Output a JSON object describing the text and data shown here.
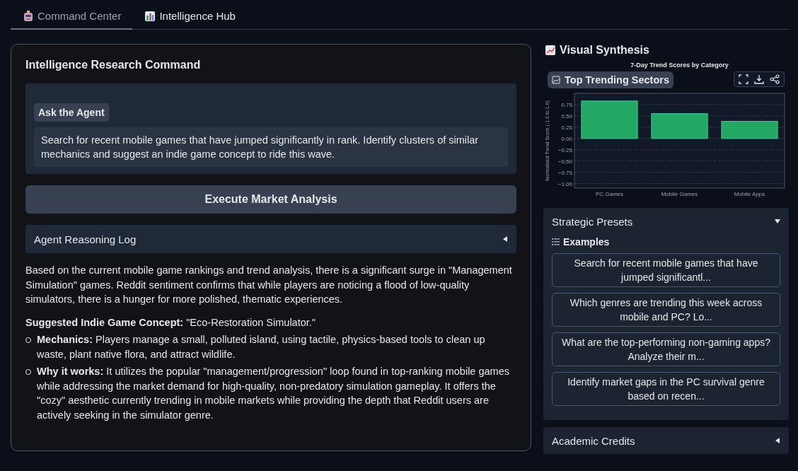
{
  "tabs": [
    {
      "label": "Command Center",
      "selected": true
    },
    {
      "label": "Intelligence Hub",
      "selected": false
    }
  ],
  "command": {
    "title": "Intelligence Research Command",
    "agent_label": "Ask the Agent",
    "query": "Search for recent mobile games that have jumped significantly in rank. Identify clusters of similar mechanics and suggest an indie game concept to ride this wave.",
    "execute_button": "Execute Market Analysis",
    "log": {
      "title": "Agent Reasoning Log",
      "expanded": false
    },
    "response": {
      "intro": "Based on the current mobile game rankings and trend analysis, there is a significant surge in \"Management Simulation\" games. Reddit sentiment confirms that while players are noticing a flood of low-quality simulators, there is a hunger for more polished, thematic experiences.",
      "concept": "**Suggested Indie Game Concept:** \"Eco-Restoration Simulator.\"",
      "bullets": [
        "**Mechanics:** Players manage a small, polluted island, using tactile, physics-based tools to clean up waste, plant native flora, and attract wildlife.",
        "**Why it works:** It utilizes the popular \"management/progression\" loop found in top-ranking mobile games while addressing the market demand for high-quality, non-predatory simulation gameplay. It offers the \"cozy\" aesthetic currently trending in mobile markets while providing the depth that Reddit users are actively seeking in the simulator genre."
      ]
    }
  },
  "visual": {
    "title": "Visual Synthesis",
    "plot_label": "Top Trending Sectors",
    "chart_data": {
      "type": "bar",
      "title": "7-Day Trend Scores by Category",
      "ylabel": "Normalized Trend Score (-1.0 to 1.0)",
      "categories": [
        "PC Games",
        "Mobile Games",
        "Mobile Apps"
      ],
      "values": [
        0.83,
        0.55,
        0.38
      ],
      "grid": true,
      "ylim": [
        -1.1,
        1.0
      ],
      "yticks": [
        {
          "value": -1,
          "label": "−1.00"
        },
        {
          "value": -0.75,
          "label": "−0.75"
        },
        {
          "value": -0.5,
          "label": "−0.50"
        },
        {
          "value": -0.25,
          "label": "−0.25"
        },
        {
          "value": 0,
          "label": "0.00"
        },
        {
          "value": 0.25,
          "label": "0.25"
        },
        {
          "value": 0.5,
          "label": "0.50"
        },
        {
          "value": 0.75,
          "label": "0.75"
        }
      ]
    }
  },
  "presets": {
    "title": "Strategic Presets",
    "expanded": true,
    "examples_label": "Examples",
    "examples": [
      "Search for recent mobile games that have jumped significantl...",
      "Which genres are trending this week across mobile and PC? Lo...",
      "What are the top-performing non-gaming apps? Analyze their m...",
      "Identify market gaps in the PC survival genre based on recen..."
    ]
  },
  "credits": {
    "title": "Academic Credits",
    "expanded": false
  }
}
